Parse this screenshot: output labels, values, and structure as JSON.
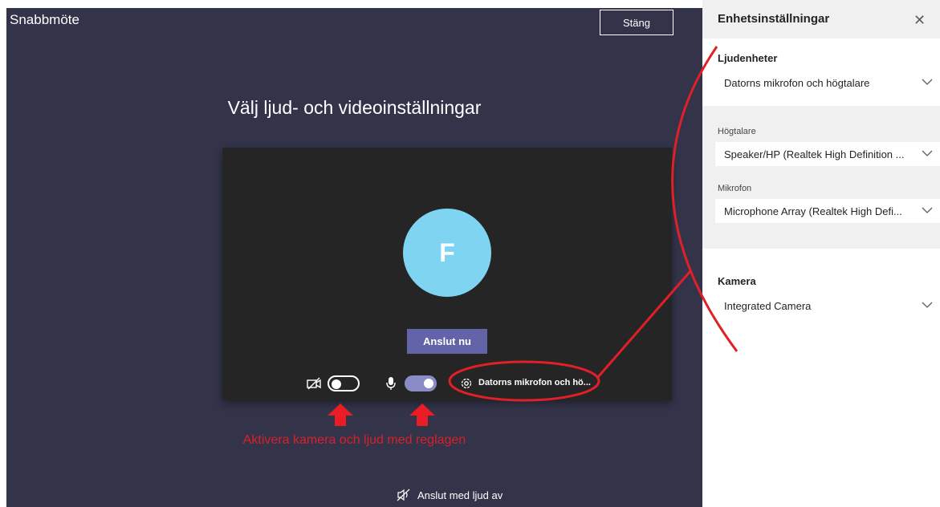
{
  "window": {
    "title": "Snabbmöte",
    "close_label": "Stäng"
  },
  "main": {
    "heading": "Välj ljud- och videoinställningar",
    "avatar_initial": "F",
    "join_label": "Anslut nu",
    "device_label": "Datorns mikrofon och hö...",
    "camera_toggle": "off",
    "mic_toggle": "on",
    "join_without_audio": "Anslut med ljud av"
  },
  "annotation": {
    "text": "Aktivera kamera och ljud med reglagen",
    "color": "#d8202a"
  },
  "panel": {
    "title": "Enhetsinställningar",
    "audio_section": "Ljudenheter",
    "audio_device": "Datorns mikrofon och högtalare",
    "speaker_label": "Högtalare",
    "speaker_value": "Speaker/HP (Realtek High Definition ...",
    "mic_label": "Mikrofon",
    "mic_value": "Microphone Array (Realtek High Defi...",
    "camera_label": "Kamera",
    "camera_value": "Integrated Camera"
  },
  "colors": {
    "background": "#33344a",
    "accent": "#6264a7",
    "avatar": "#7fd4f2"
  }
}
